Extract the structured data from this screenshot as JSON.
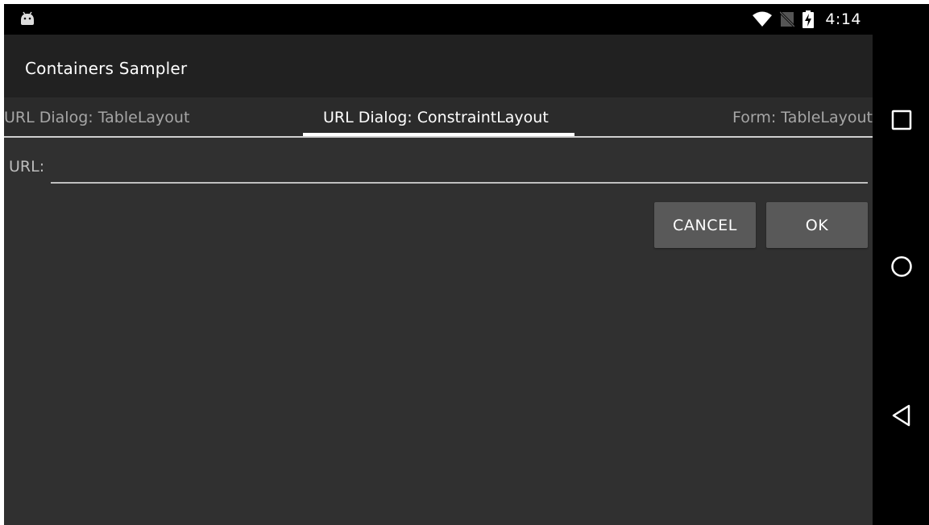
{
  "status_bar": {
    "time": "4:14",
    "icons": [
      "android-notification-icon",
      "wifi-icon",
      "no-sim-icon",
      "battery-charging-icon"
    ]
  },
  "app_bar": {
    "title": "Containers Sampler"
  },
  "tabs": [
    {
      "label": "URL Dialog: TableLayout",
      "selected": false
    },
    {
      "label": "URL Dialog: ConstraintLayout",
      "selected": true
    },
    {
      "label": "Form: TableLayout",
      "selected": false
    }
  ],
  "form": {
    "url_label": "URL:",
    "url_value": "",
    "url_placeholder": ""
  },
  "buttons": {
    "cancel_label": "CANCEL",
    "ok_label": "OK"
  },
  "nav_bar": {
    "icons": [
      "recents-square-icon",
      "home-circle-icon",
      "back-triangle-icon"
    ]
  },
  "colors": {
    "background": "#303030",
    "app_bar": "#212121",
    "tab_bar": "#2b2b2b",
    "tab_indicator": "#ffffff",
    "button": "#595959",
    "system_bars": "#000000"
  }
}
